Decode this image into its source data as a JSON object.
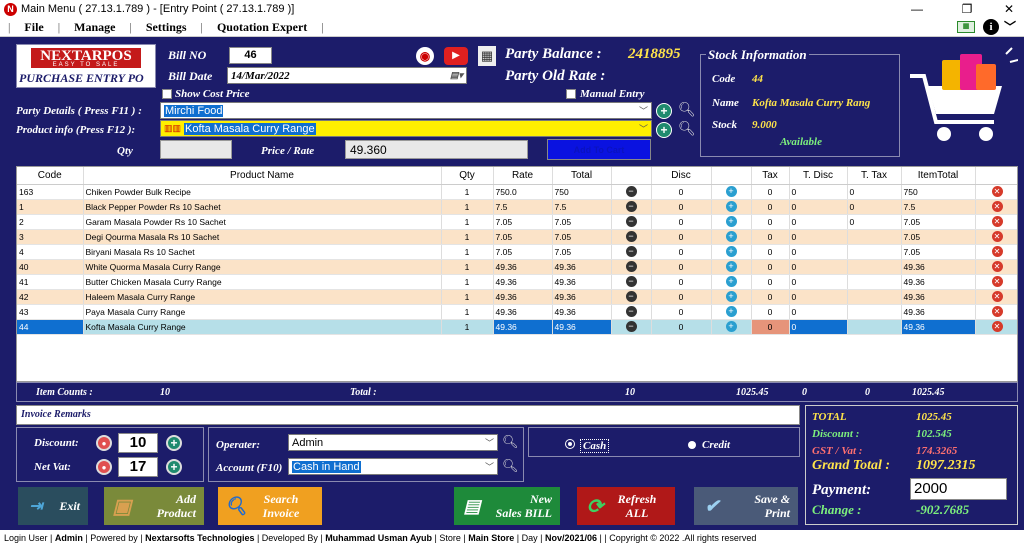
{
  "window": {
    "title": "Main Menu ( 27.13.1.789 ) - [Entry Point ( 27.13.1.789 )]",
    "minimize": "—",
    "restore": "❐",
    "close": "✕"
  },
  "menu": [
    "File",
    "Manage",
    "Settings",
    "Quotation Expert"
  ],
  "brand": {
    "name": "NEXTARPOS",
    "tagline": "EASY TO SALE",
    "module": "PURCHASE ENTRY PO"
  },
  "bill": {
    "no_label": "Bill NO",
    "no_value": "46",
    "date_label": "Bill Date",
    "date_value": "14/Mar/2022"
  },
  "options": {
    "show_cost_price": "Show Cost Price",
    "manual_entry": "Manual Entry"
  },
  "party": {
    "balance_label": "Party Balance :",
    "balance_value": "2418895",
    "old_rate_label": "Party Old Rate :",
    "details_label": "Party Details ( Press F11 ) :",
    "details_value": "Mirchi Food",
    "product_label": "Product info (Press F12 ):",
    "product_value": "Kofta  Masala  Curry Range",
    "qty_label": "Qty",
    "rate_label": "Price / Rate",
    "rate_value": "49.360",
    "add_to_cart": "Add To Cart"
  },
  "stock": {
    "title": "Stock Information",
    "code_label": "Code",
    "code_value": "44",
    "name_label": "Name",
    "name_value": "Kofta  Masala  Curry Rang",
    "stock_label": "Stock",
    "stock_value": "9.000",
    "status": "Available"
  },
  "grid": {
    "columns": [
      "Code",
      "Product Name",
      "Qty",
      "Rate",
      "Total",
      "",
      "Disc",
      "",
      "Tax",
      "T. Disc",
      "T. Tax",
      "ItemTotal",
      ""
    ],
    "rows": [
      {
        "code": "163",
        "name": "Chiken Powder Bulk Recipe",
        "qty": "1",
        "rate": "750.0",
        "total": "750",
        "disc": "0",
        "tax": "0",
        "tdisc": "0",
        "ttax": "0",
        "item": "750"
      },
      {
        "code": "1",
        "name": "Black Pepper Powder Rs 10 Sachet",
        "qty": "1",
        "rate": "7.5",
        "total": "7.5",
        "disc": "0",
        "tax": "0",
        "tdisc": "0",
        "ttax": "0",
        "item": "7.5"
      },
      {
        "code": "2",
        "name": "Garam Masala Powder Rs 10 Sachet",
        "qty": "1",
        "rate": "7.05",
        "total": "7.05",
        "disc": "0",
        "tax": "0",
        "tdisc": "0",
        "ttax": "0",
        "item": "7.05"
      },
      {
        "code": "3",
        "name": "Degi Qourma Masala  Rs 10 Sachet",
        "qty": "1",
        "rate": "7.05",
        "total": "7.05",
        "disc": "0",
        "tax": "0",
        "tdisc": "0",
        "ttax": "",
        "item": "7.05"
      },
      {
        "code": "4",
        "name": "Biryani Masala  Rs 10 Sachet",
        "qty": "1",
        "rate": "7.05",
        "total": "7.05",
        "disc": "0",
        "tax": "0",
        "tdisc": "0",
        "ttax": "",
        "item": "7.05"
      },
      {
        "code": "40",
        "name": "White Quorma Masala Curry Range",
        "qty": "1",
        "rate": "49.36",
        "total": "49.36",
        "disc": "0",
        "tax": "0",
        "tdisc": "0",
        "ttax": "",
        "item": "49.36"
      },
      {
        "code": "41",
        "name": "Butter Chicken Masala Curry Range",
        "qty": "1",
        "rate": "49.36",
        "total": "49.36",
        "disc": "0",
        "tax": "0",
        "tdisc": "0",
        "ttax": "",
        "item": "49.36"
      },
      {
        "code": "42",
        "name": "Haleem Masala Curry Range",
        "qty": "1",
        "rate": "49.36",
        "total": "49.36",
        "disc": "0",
        "tax": "0",
        "tdisc": "0",
        "ttax": "",
        "item": "49.36"
      },
      {
        "code": "43",
        "name": "Paya Masala Curry Range",
        "qty": "1",
        "rate": "49.36",
        "total": "49.36",
        "disc": "0",
        "tax": "0",
        "tdisc": "0",
        "ttax": "",
        "item": "49.36"
      },
      {
        "code": "44",
        "name": "Kofta  Masala  Curry Range",
        "qty": "1",
        "rate": "49.36",
        "total": "49.36",
        "disc": "0",
        "tax": "0",
        "tdisc": "0",
        "ttax": "",
        "item": "49.36"
      }
    ]
  },
  "footer_totals": {
    "item_counts_label": "Item Counts :",
    "item_counts": "10",
    "total_label": "Total :",
    "qty_total": "10",
    "amount_total": "1025.45",
    "disc_total": "0",
    "tax_total": "0",
    "item_total": "1025.45"
  },
  "remarks": {
    "label": "Invoice Remarks"
  },
  "discount": {
    "label": "Discount:",
    "value": "10",
    "net_vat_label": "Net Vat:",
    "net_vat_value": "17"
  },
  "operator": {
    "label": "Operater:",
    "value": "Admin",
    "account_label": "Account (F10)",
    "account_value": "Cash in Hand"
  },
  "payment_mode": {
    "cash": "Cash",
    "credit": "Credit"
  },
  "summary": {
    "total_label": "TOTAL",
    "total_value": "1025.45",
    "discount_label": "Discount :",
    "discount_value": "102.545",
    "gst_label": "GST / Vat :",
    "gst_value": "174.3265",
    "grand_label": "Grand Total :",
    "grand_value": "1097.2315",
    "payment_label": "Payment:",
    "payment_value": "2000",
    "change_label": "Change :",
    "change_value": "-902.7685"
  },
  "buttons": {
    "exit": "Exit",
    "add_product_1": "Add",
    "add_product_2": "Product",
    "search_1": "Search",
    "search_2": "Invoice",
    "new_1": "New",
    "new_2": "Sales BILL",
    "refresh_1": "Refresh",
    "refresh_2": "ALL",
    "save_1": "Save &",
    "save_2": "Print"
  },
  "status": {
    "login_label": "Login User",
    "login_value": "Admin",
    "powered_label": "Powered by",
    "powered_value": "Nextarsofts Technologies",
    "dev_label": "Developed By",
    "dev_value": "Muhammad Usman Ayub",
    "store_label": "Store",
    "store_value": "Main Store",
    "day_label": "Day",
    "day_value": "Nov/2021/06",
    "copyright": "Copyright © 2022  .All rights reserved"
  },
  "colors": {
    "accent_yellow": "#ffe44a",
    "panel": "#1c1c6a",
    "grid_odd": "#fbe3c8",
    "selected": "#0f6fd0"
  }
}
